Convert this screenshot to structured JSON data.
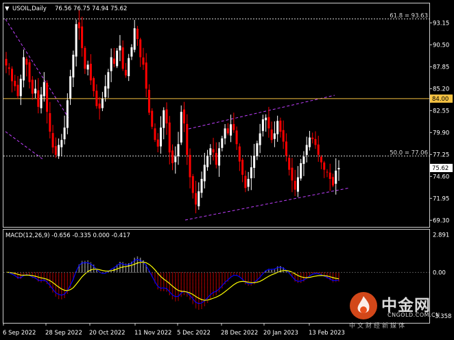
{
  "header": {
    "arrow": "▼",
    "symbol": "USOIL,Daily",
    "ohlc": "76.56 76.75 74.94 75.62"
  },
  "macd_header": "MACD(12,26,9) -0.656 -0.335 0.000 -0.417",
  "fib_levels": [
    {
      "label": "61.8 = 93.63",
      "value": 93.63
    },
    {
      "label": "50.0 = 77.06",
      "value": 77.06
    }
  ],
  "horizontal_line": {
    "label": "84.00",
    "value": 84.0,
    "color": "#f5c242"
  },
  "current_price": {
    "label": "75.62",
    "value": 75.62
  },
  "price_axis": [
    {
      "label": "93.15",
      "value": 93.15
    },
    {
      "label": "90.50",
      "value": 90.5
    },
    {
      "label": "87.85",
      "value": 87.85
    },
    {
      "label": "85.20",
      "value": 85.2
    },
    {
      "label": "82.55",
      "value": 82.55
    },
    {
      "label": "79.90",
      "value": 79.9
    },
    {
      "label": "77.25",
      "value": 77.25
    },
    {
      "label": "74.60",
      "value": 74.6
    },
    {
      "label": "71.95",
      "value": 71.95
    },
    {
      "label": "69.30",
      "value": 69.3
    }
  ],
  "price_range": [
    68.5,
    95.5
  ],
  "macd_axis": [
    {
      "label": "2.891",
      "value": 2.891
    },
    {
      "label": "0.00",
      "value": 0.0
    },
    {
      "label": "-3.358",
      "value": -3.358
    }
  ],
  "macd_range": [
    -3.9,
    3.3
  ],
  "time_axis": [
    "6 Sep 2022",
    "28 Sep 2022",
    "20 Oct 2022",
    "11 Nov 2022",
    "5 Dec 2022",
    "28 Dec 2022",
    "20 Jan 2023",
    "13 Feb 2023"
  ],
  "colors": {
    "bull": "#ffffff",
    "bear": "#ff0000",
    "grid": "#d8d8d8",
    "channel": "#c040ff",
    "signal": "#ffff00",
    "macd_line": "#0000ff",
    "axis_box": "#ffffff"
  },
  "watermark": {
    "cn": "中金网",
    "en": "CNGOLD.COM.CN",
    "sub": "中文财经新媒体"
  },
  "chart_data": {
    "type": "candlestick",
    "series": [
      {
        "name": "USOIL,Daily",
        "close": [
          88,
          87.6,
          86.1,
          85.5,
          84.3,
          86.4,
          89,
          88.1,
          86,
          84.6,
          85.2,
          83,
          84.5,
          86,
          82.4,
          80,
          78.1,
          77.2,
          78.4,
          79,
          80.5,
          83.8,
          86.7,
          89.3,
          93,
          92.5,
          90.1,
          87.6,
          88.1,
          86.2,
          84.9,
          83.1,
          82.8,
          84,
          85.5,
          87.2,
          89,
          88.2,
          89.8,
          90.4,
          87.6,
          86.8,
          88.9,
          90.2,
          92.5,
          91.2,
          89,
          88.1,
          85.2,
          82.3,
          80.6,
          79,
          78.2,
          80.5,
          82.6,
          81,
          77.5,
          76.2,
          77,
          78.5,
          82.4,
          81,
          77.2,
          74.5,
          72.6,
          71.2,
          72.8,
          74.3,
          76,
          77.1,
          78,
          77.5,
          76,
          78,
          79.2,
          80.4,
          79.8,
          80.9,
          80.2,
          78.5,
          76.4,
          74.8,
          73.2,
          74.3,
          75.7,
          77.1,
          78.6,
          79.8,
          81.5,
          81.7,
          80.4,
          79,
          79.8,
          81.3,
          80,
          78.8,
          77.1,
          75.4,
          74.1,
          73,
          74.5,
          76.2,
          77,
          78.4,
          79.3,
          79.1,
          78.4,
          77.2,
          76.3,
          75.4,
          75.1,
          74.3,
          73.5,
          75.3,
          75.62
        ]
      }
    ]
  }
}
